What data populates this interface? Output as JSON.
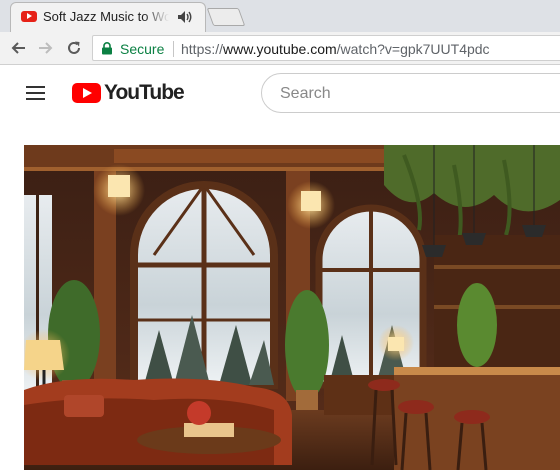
{
  "browser": {
    "tab": {
      "title": "Soft Jazz Music to Work",
      "favicon": "youtube-favicon-icon",
      "audio_indicator": "speaker-icon"
    },
    "new_tab": "new-tab-button",
    "nav": {
      "back": "arrow-left-icon",
      "forward": "arrow-right-icon",
      "reload": "reload-icon"
    },
    "omnibox": {
      "security_icon": "lock-icon",
      "security_label": "Secure",
      "url_scheme": "https://",
      "url_host": "www.youtube.com",
      "url_path": "/watch?v=gpk7UUT4pdc"
    }
  },
  "youtube": {
    "menu_icon": "hamburger-menu-icon",
    "logo_text": "YouTube",
    "search": {
      "placeholder": "Search",
      "value": ""
    }
  },
  "player": {
    "thumbnail": "cozy-jazz-cafe-winter-scene"
  },
  "colors": {
    "brand_red": "#ff0000",
    "secure_green": "#0b8043",
    "tab_bg": "#f2f2f2",
    "tabstrip_bg": "#dee1e6"
  }
}
